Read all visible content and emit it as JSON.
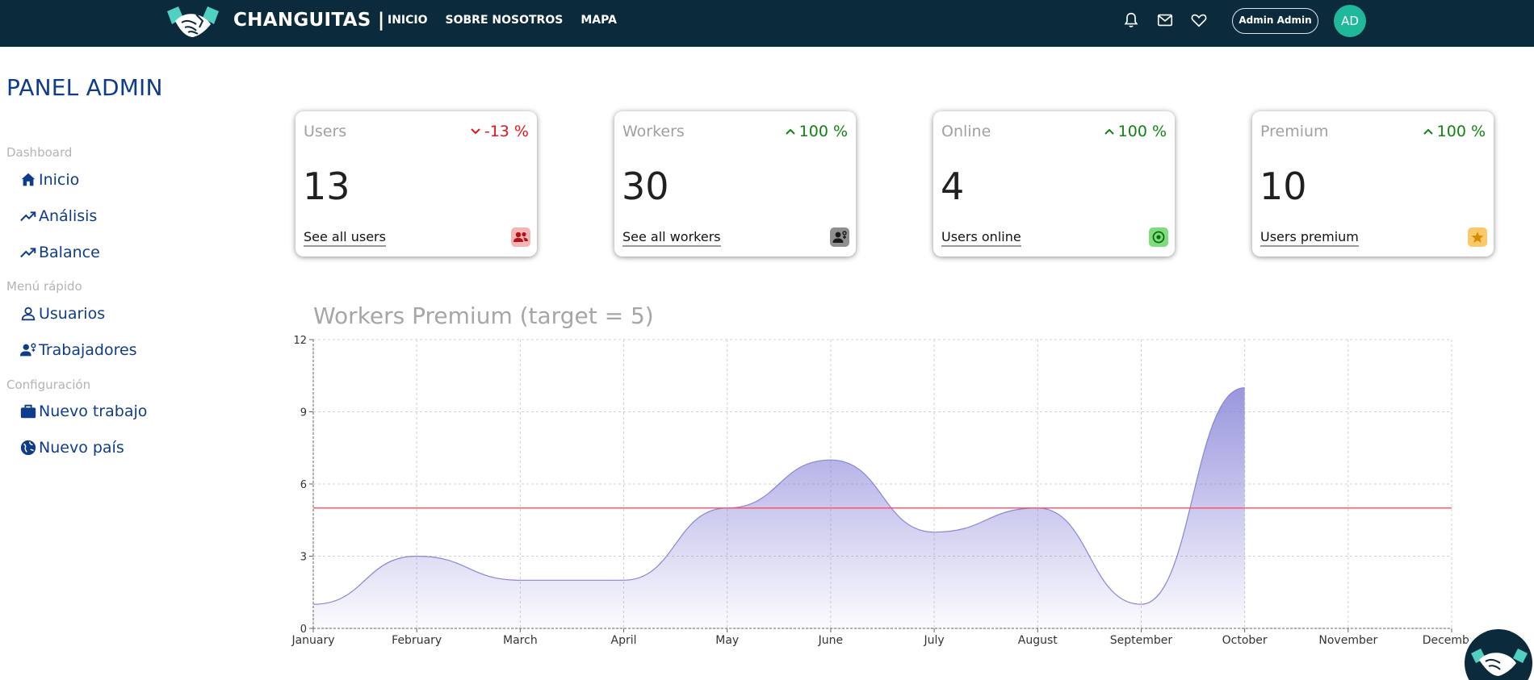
{
  "header": {
    "brand": "CHANGUITAS |",
    "nav": [
      "INICIO",
      "SOBRE NOSOTROS",
      "MAPA"
    ],
    "icons": [
      "bell-icon",
      "mail-icon",
      "heart-icon"
    ],
    "user_name": "Admin Admin",
    "avatar_initials": "AD",
    "avatar_color": "#1fb89a",
    "bg_color": "#0b2a3c"
  },
  "sidebar": {
    "title": "PANEL ADMIN",
    "sections": [
      {
        "label": "Dashboard",
        "items": [
          {
            "label": "Inicio",
            "icon": "home-icon"
          },
          {
            "label": "Análisis",
            "icon": "trending-up-icon"
          },
          {
            "label": "Balance",
            "icon": "trending-up-icon"
          }
        ]
      },
      {
        "label": "Menú rápido",
        "items": [
          {
            "label": "Usuarios",
            "icon": "user-icon"
          },
          {
            "label": "Trabajadores",
            "icon": "worker-icon"
          }
        ]
      },
      {
        "label": "Configuración",
        "items": [
          {
            "label": "Nuevo trabajo",
            "icon": "briefcase-icon"
          },
          {
            "label": "Nuevo país",
            "icon": "globe-icon"
          }
        ]
      }
    ]
  },
  "cards": [
    {
      "title": "Users",
      "change": "-13 %",
      "direction": "down",
      "value": "13",
      "link": "See all users",
      "badge_icon": "users-icon",
      "badge_color": "#f6b5b5"
    },
    {
      "title": "Workers",
      "change": "100 %",
      "direction": "up",
      "value": "30",
      "link": "See all workers",
      "badge_icon": "worker-icon",
      "badge_color": "#8f8f8f"
    },
    {
      "title": "Online",
      "change": "100 %",
      "direction": "up",
      "value": "4",
      "link": "Users online",
      "badge_icon": "online-icon",
      "badge_color": "#7fdc7f"
    },
    {
      "title": "Premium",
      "change": "100 %",
      "direction": "up",
      "value": "10",
      "link": "Users premium",
      "badge_icon": "star-icon",
      "badge_color": "#f9c96a"
    }
  ],
  "chart_data": {
    "type": "area",
    "title": "Workers Premium (target = 5)",
    "categories": [
      "January",
      "February",
      "March",
      "April",
      "May",
      "June",
      "July",
      "August",
      "September",
      "October",
      "November",
      "December"
    ],
    "series": [
      {
        "values": [
          1,
          3,
          2,
          2,
          5,
          7,
          4,
          5,
          1,
          10
        ],
        "color": "#8884d8"
      }
    ],
    "reference_line": {
      "y": 5,
      "color": "#ff4d5e"
    },
    "ylim": [
      0,
      12
    ],
    "yticks": [
      0,
      3,
      6,
      9,
      12
    ],
    "grid": true
  }
}
